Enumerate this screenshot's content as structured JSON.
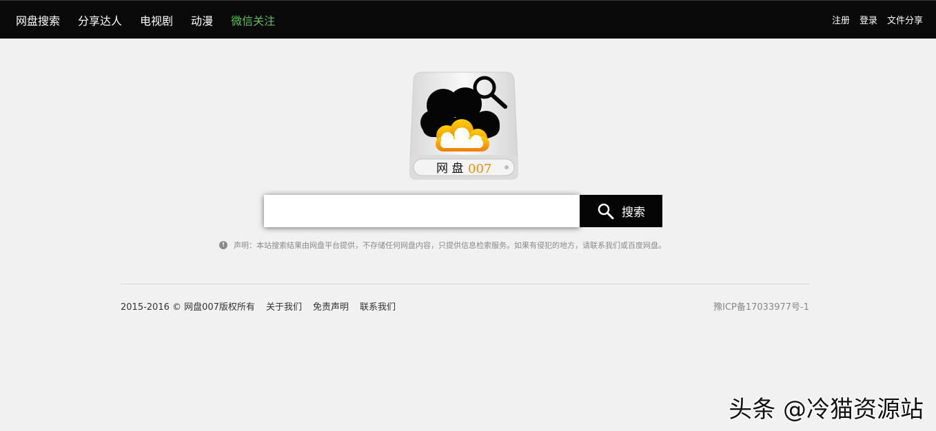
{
  "nav": {
    "left": [
      {
        "label": "网盘搜索"
      },
      {
        "label": "分享达人"
      },
      {
        "label": "电视剧"
      },
      {
        "label": "动漫"
      },
      {
        "label": "微信关注"
      }
    ],
    "right": [
      {
        "label": "注册"
      },
      {
        "label": "登录"
      },
      {
        "label": "文件分享"
      }
    ]
  },
  "logo": {
    "text": "网 盘",
    "number": "007"
  },
  "search": {
    "value": "",
    "button_label": "搜索"
  },
  "notice": {
    "text": "声明：本站搜索结果由网盘平台提供，不存储任何网盘内容，只提供信息检索服务。如果有侵犯的地方，请联系我们或百度网盘。"
  },
  "footer": {
    "copyright": "2015-2016 © 网盘007版权所有",
    "links": [
      "关于我们",
      "免责声明",
      "联系我们"
    ],
    "icp": "豫ICP备17033977号-1"
  },
  "watermark": "头条 @冷猫资源站",
  "colors": {
    "nav_bg": "#0a0a0a",
    "page_bg": "#f1f1f1",
    "highlight_green": "#5bbf5b",
    "logo_orange": "#f08a00"
  }
}
